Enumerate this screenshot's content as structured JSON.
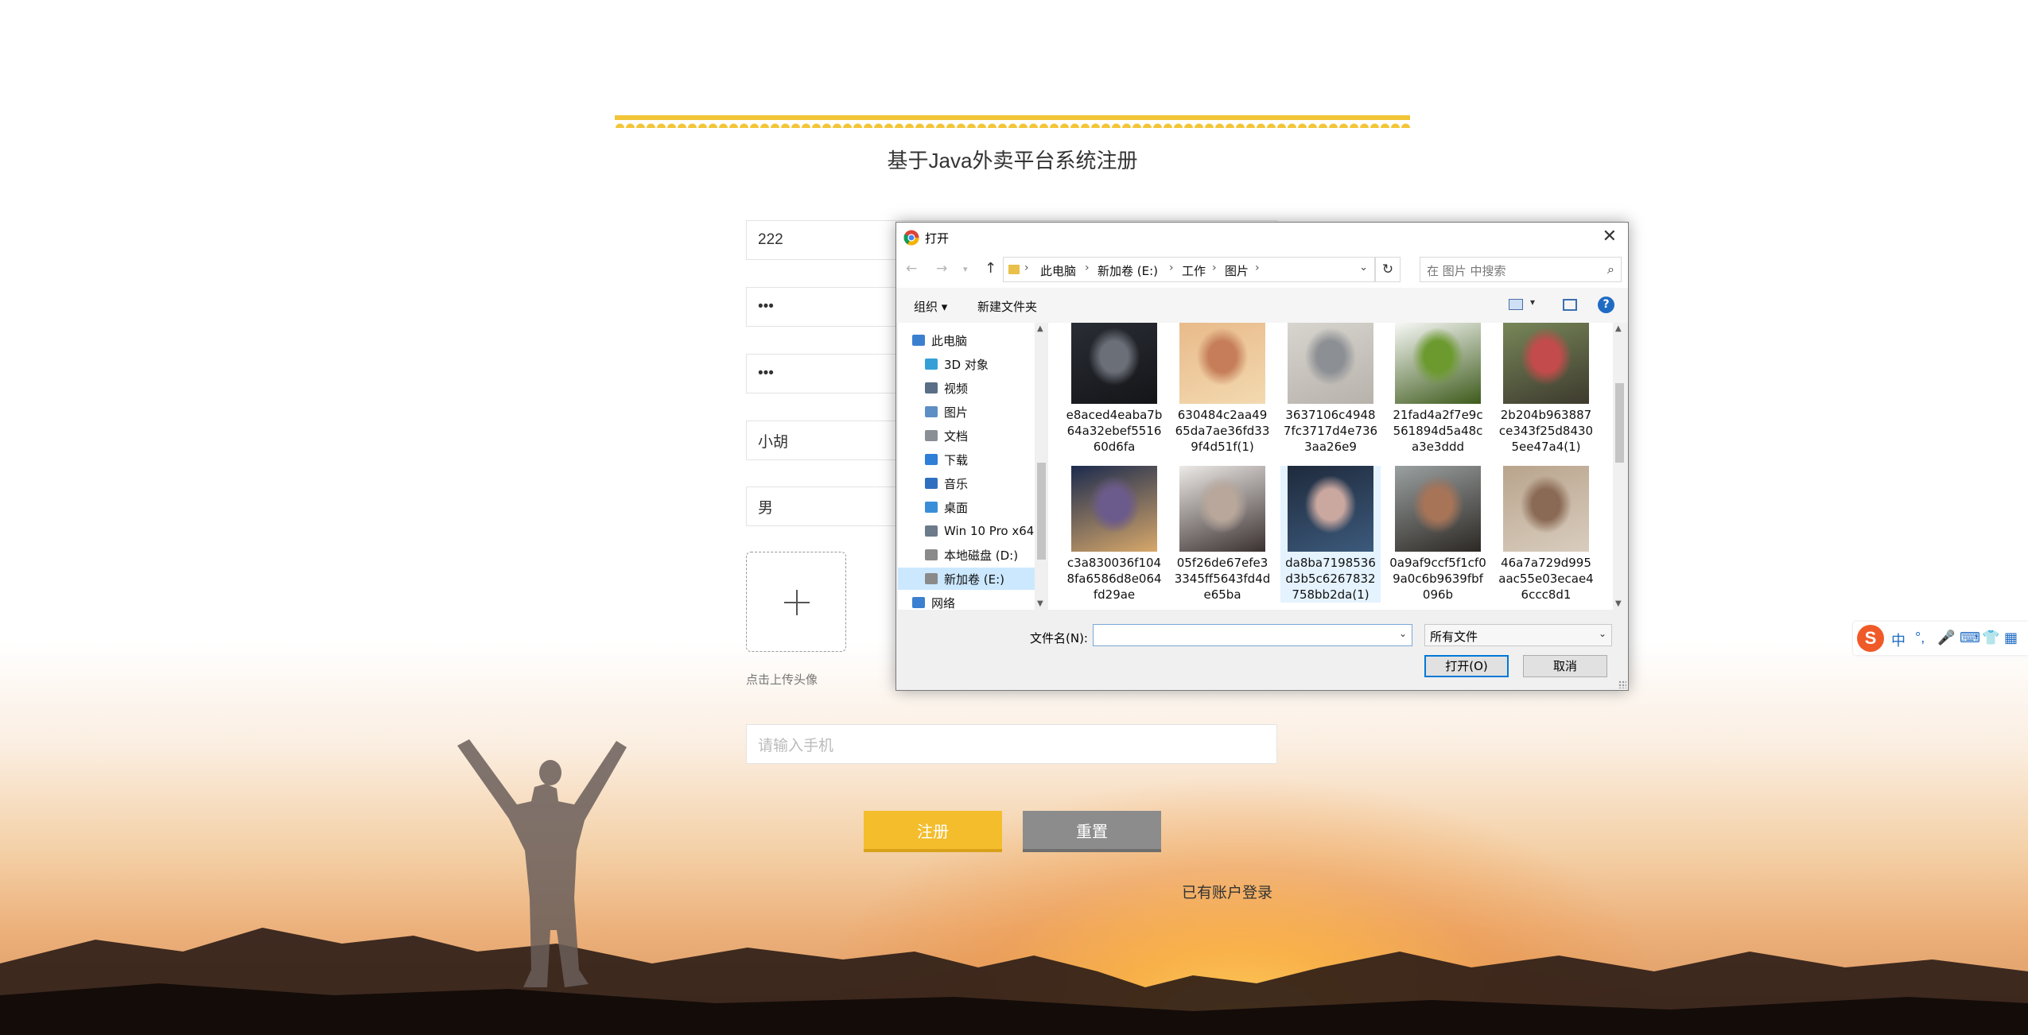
{
  "page": {
    "title": "基于Java外卖平台系统注册",
    "fields": [
      {
        "value": "222",
        "placeholder": ""
      },
      {
        "value": "•••",
        "placeholder": ""
      },
      {
        "value": "•••",
        "placeholder": ""
      },
      {
        "value": "小胡",
        "placeholder": ""
      },
      {
        "value": "男",
        "placeholder": ""
      }
    ],
    "upload_tip": "点击上传头像",
    "phone_placeholder": "请输入手机",
    "register_label": "注册",
    "reset_label": "重置",
    "login_link": "已有账户登录"
  },
  "dialog": {
    "title": "打开",
    "close": "✕",
    "breadcrumb": [
      "此电脑",
      "新加卷 (E:)",
      "工作",
      "图片"
    ],
    "search_placeholder": "在 图片 中搜索",
    "toolbar": {
      "organize": "组织 ▾",
      "new_folder": "新建文件夹",
      "help": "?"
    },
    "nav_items": [
      {
        "label": "此电脑",
        "icon": "computer-icon",
        "color": "#3b7fd0"
      },
      {
        "label": "3D 对象",
        "icon": "3d-objects-icon",
        "color": "#35a0d6"
      },
      {
        "label": "视频",
        "icon": "video-icon",
        "color": "#5a6e86"
      },
      {
        "label": "图片",
        "icon": "pictures-icon",
        "color": "#5e8fc4"
      },
      {
        "label": "文档",
        "icon": "documents-icon",
        "color": "#8a8f96"
      },
      {
        "label": "下载",
        "icon": "downloads-icon",
        "color": "#2f7ed8"
      },
      {
        "label": "音乐",
        "icon": "music-icon",
        "color": "#2f6fc0"
      },
      {
        "label": "桌面",
        "icon": "desktop-icon",
        "color": "#3a8ed8"
      },
      {
        "label": "Win 10 Pro x64",
        "icon": "network-drive-icon",
        "color": "#6c7a8a"
      },
      {
        "label": "本地磁盘 (D:)",
        "icon": "disk-icon",
        "color": "#8a8a8a"
      },
      {
        "label": "新加卷 (E:)",
        "icon": "disk-icon",
        "color": "#8a8a8a"
      },
      {
        "label": "网络",
        "icon": "network-icon",
        "color": "#3b7fd0"
      }
    ],
    "selected_nav": 10,
    "files": [
      {
        "name": "e8aced4eaba7b64a32ebef551660d6fa",
        "colors": [
          "#2a2e36",
          "#6b6f78",
          "#141518"
        ]
      },
      {
        "name": "630484c2aa4965da7ae36fd339f4d51f(1)",
        "colors": [
          "#e8b989",
          "#c57e59",
          "#f3d9b0"
        ]
      },
      {
        "name": "3637106c49487fc3717d4e7363aa26e9",
        "colors": [
          "#d9d6d0",
          "#8c8f94",
          "#b7b2ab"
        ]
      },
      {
        "name": "21fad4a2f7e9c561894d5a48ca3e3ddd",
        "colors": [
          "#ffffff",
          "#6c9a2f",
          "#3e5b1c"
        ]
      },
      {
        "name": "2b204b963887ce343f25d84305ee47a4(1)",
        "colors": [
          "#7a8a5a",
          "#c44b4b",
          "#3d3a2e"
        ]
      },
      {
        "name": "c3a830036f1048fa6586d8e064fd29ae",
        "colors": [
          "#1c2b4e",
          "#6b5a8c",
          "#d7a86a"
        ]
      },
      {
        "name": "05f26de67efe33345ff5643fd4de65ba",
        "colors": [
          "#ece9e6",
          "#b8a79a",
          "#3a3030"
        ]
      },
      {
        "name": "da8ba7198536d3b5c6267832758bb2da(1)",
        "colors": [
          "#1f2a3c",
          "#caa8a0",
          "#3c5a7c"
        ]
      },
      {
        "name": "0a9af9ccf5f1cf09a0c6b9639fbf096b",
        "colors": [
          "#9aa0a0",
          "#a77458",
          "#2c2824"
        ]
      },
      {
        "name": "46a7a729d995aac55e03ecae46ccc8d1",
        "colors": [
          "#b9a48c",
          "#8a6a55",
          "#d9cdbf"
        ]
      }
    ],
    "selected_file": 7,
    "filename_label": "文件名(N):",
    "filename_value": "",
    "filetype": "所有文件",
    "open_label": "打开(O)",
    "cancel_label": "取消"
  },
  "ime": {
    "logo": "S",
    "items": [
      "中",
      "°,",
      "🎤",
      "⌨",
      "👕",
      "▦"
    ]
  },
  "colors": {
    "accent_yellow": "#f3bd2c",
    "reset_gray": "#8c8c8c",
    "selection_blue": "#cce8ff"
  }
}
